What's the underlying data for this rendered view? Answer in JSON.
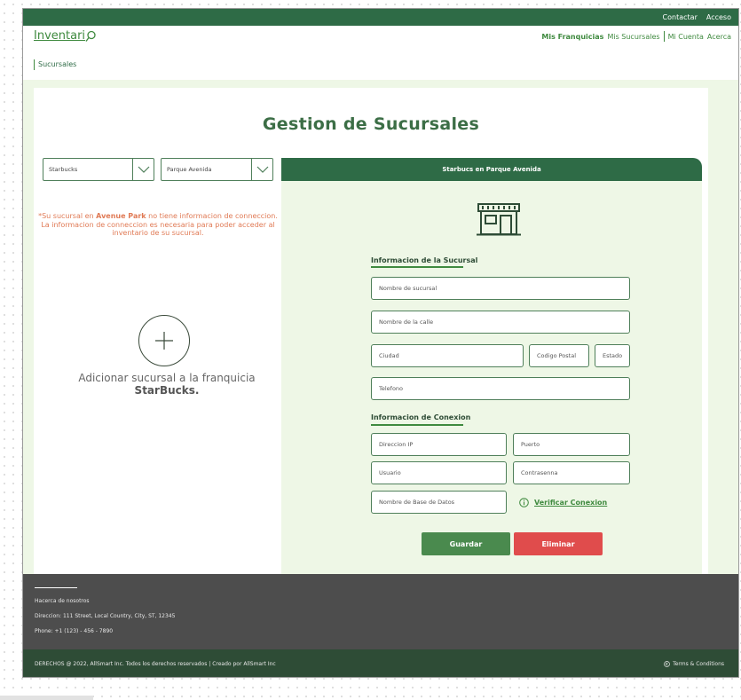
{
  "topbar": {
    "contact": "Contactar",
    "access": "Acceso"
  },
  "header": {
    "logo_text": "Inventari",
    "nav": {
      "my_franchises": "Mis Franquicias",
      "my_branches": "Mis Sucursales",
      "my_account": "Mi Cuenta",
      "about": "Acerca"
    }
  },
  "breadcrumb": "Sucursales",
  "page": {
    "title": "Gestion de Sucursales"
  },
  "selects": {
    "franchise": "Starbucks",
    "branch": "Parque Avenida"
  },
  "warning": {
    "prefix": "*Su sucursal en ",
    "highlight": "Avenue Park",
    "suffix": " no tiene informacion de conneccion.  La informacion de conneccion es necesaria para poder acceder al inventario de su sucursal."
  },
  "add_branch": {
    "text": "Adicionar sucursal a la franquicia",
    "franchise": "StarBucks."
  },
  "panel": {
    "title": "Starbucs en Parque Avenida"
  },
  "branch_info": {
    "title": "Informacion de la Sucursal",
    "name": "Nombre de sucursal",
    "street": "Nombre de la calle",
    "city": "Ciudad",
    "postal": "Codigo Postal",
    "state": "Estado",
    "phone": "Telefono"
  },
  "connection_info": {
    "title": "Informacion de Conexion",
    "ip": "Direccion IP",
    "port": "Puerto",
    "user": "Usuario",
    "password": "Contrasenna",
    "database": "Nombre de Base de Datos",
    "verify": "Verificar Conexion"
  },
  "buttons": {
    "save": "Guardar",
    "delete": "Eliminar"
  },
  "footer": {
    "about": "Hacerca de nosotros",
    "address": "Direccion: 111 Street, Local Country, City, ST, 12345",
    "phone": "Phone: +1 (123) - 456 - 7890",
    "rights": "DERECHOS @ 2022, AllSmart Inc. Todos los derechos reservados | Creado por AllSmart Inc",
    "terms": "Terms & Conditions"
  },
  "colors": {
    "primary_green": "#2e6b46",
    "accent_green": "#3f8a3f",
    "light_green_bg": "#eef7e6",
    "save_button": "#4a8a4e",
    "delete_button": "#e04c4c",
    "warning_text": "#e07a55",
    "footer_bg": "#4d4d4d"
  }
}
